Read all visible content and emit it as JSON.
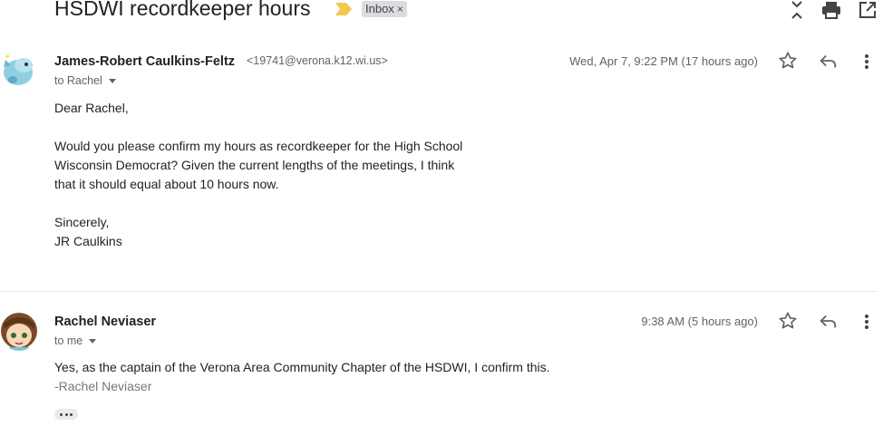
{
  "thread": {
    "subject": "HSDWI recordkeeper hours",
    "label_chip": "Inbox",
    "label_chip_close": "×"
  },
  "messages": [
    {
      "sender_name": "James-Robert Caulkins-Feltz",
      "sender_email": "<19741@verona.k12.wi.us>",
      "recipient": "to Rachel",
      "date": "Wed, Apr 7, 9:22 PM (17 hours ago)",
      "body": [
        "Dear Rachel,",
        "Would you please confirm my hours as recordkeeper for the High School",
        "Wisconsin Democrat? Given the current lengths of the meetings, I think",
        "that it should equal about 10 hours now.",
        "Sincerely,",
        "JR Caulkins"
      ]
    },
    {
      "sender_name": "Rachel Neviaser",
      "recipient": "to me",
      "date": "9:38 AM (5 hours ago)",
      "body": [
        "Yes, as the captain of the Verona Area Community Chapter of the HSDWI, I confirm this."
      ],
      "signature": "-Rachel Neviaser"
    }
  ],
  "colors": {
    "importance_marker": "#f2c94c",
    "chip_bg": "#dadce0",
    "icon_gray": "#5f6368"
  }
}
